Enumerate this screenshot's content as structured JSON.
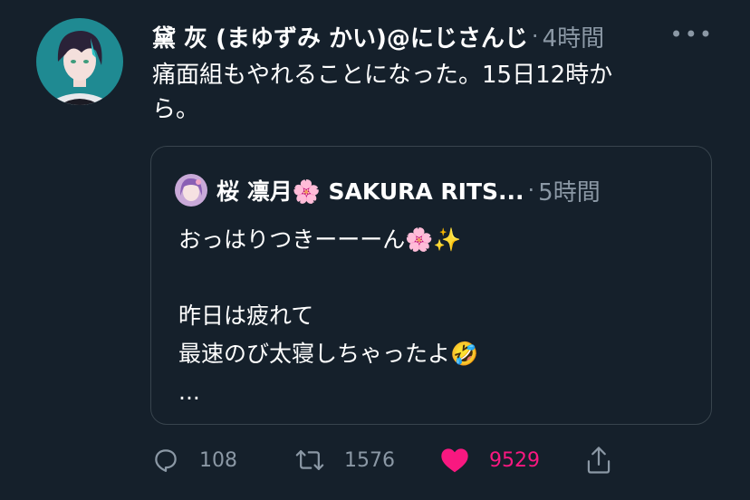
{
  "tweet": {
    "author_name": "黛 灰 (まゆずみ かい)@にじさんじ",
    "separator": "·",
    "time": "4時間",
    "more": "•••",
    "text_line1": "痛面組もやれることになった。15日12時か",
    "text_line2": "ら。"
  },
  "quote": {
    "author_name": "桜 凛月🌸  SAKURA RITS...",
    "separator": "·",
    "time": "5時間",
    "text": "おっはりつきーーーん🌸✨\n\n昨日は疲れて\n最速のび太寝しちゃったよ🤣\n..."
  },
  "actions": {
    "reply_count": "108",
    "retweet_count": "1576",
    "like_count": "9529"
  },
  "colors": {
    "background": "#15202b",
    "secondary_text": "#8b98a5",
    "border": "#38444d",
    "like": "#f91880"
  }
}
